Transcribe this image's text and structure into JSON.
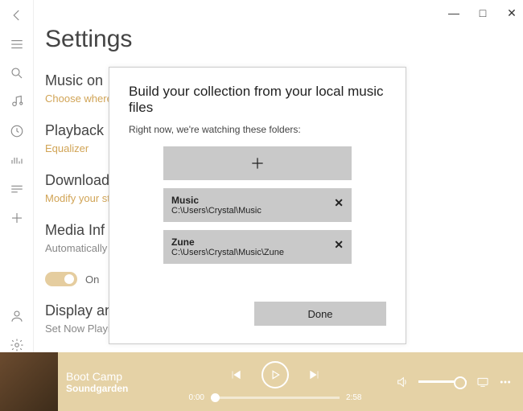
{
  "titlebar": {
    "min": "—",
    "max": "□",
    "close": "✕"
  },
  "page": {
    "title": "Settings"
  },
  "sections": {
    "music": {
      "heading": "Music on",
      "sub": "Choose where"
    },
    "playback": {
      "heading": "Playback",
      "sub": "Equalizer"
    },
    "downloads": {
      "heading": "Download",
      "sub": "Modify your st"
    },
    "media": {
      "heading": "Media Inf",
      "sub": "Automatically",
      "toggle": "On"
    },
    "display": {
      "heading": "Display an",
      "sub": "Set Now Playin"
    }
  },
  "modal": {
    "title": "Build your collection from your local music files",
    "sub": "Right now, we're watching these folders:",
    "folders": [
      {
        "name": "Music",
        "path": "C:\\Users\\Crystal\\Music"
      },
      {
        "name": "Zune",
        "path": "C:\\Users\\Crystal\\Music\\Zune"
      }
    ],
    "done": "Done"
  },
  "player": {
    "track": "Boot Camp",
    "artist": "Soundgarden",
    "elapsed": "0:00",
    "total": "2:58"
  }
}
